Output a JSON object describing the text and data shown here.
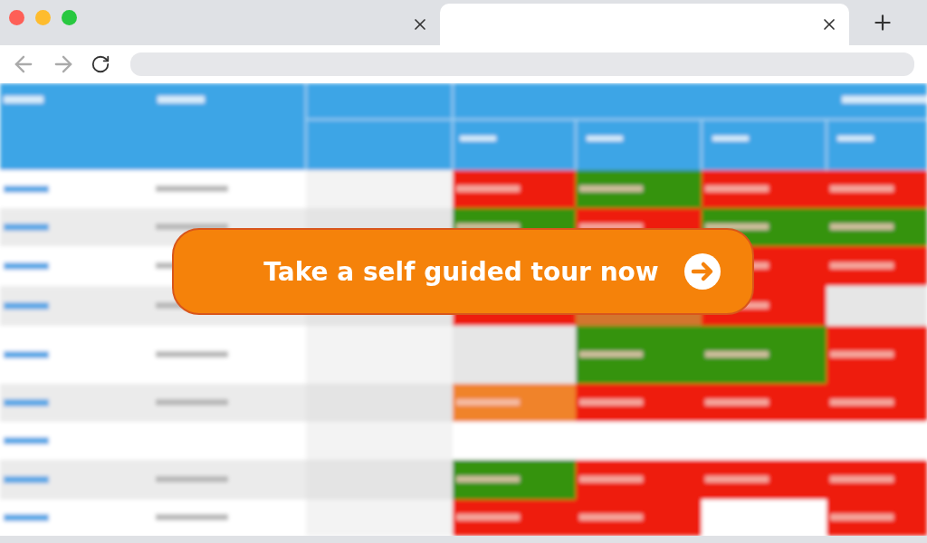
{
  "browser": {
    "tabs": [
      {
        "selected": false
      },
      {
        "selected": true
      }
    ]
  },
  "content": {
    "cta_button": {
      "label": "Take a self guided tour now"
    }
  }
}
